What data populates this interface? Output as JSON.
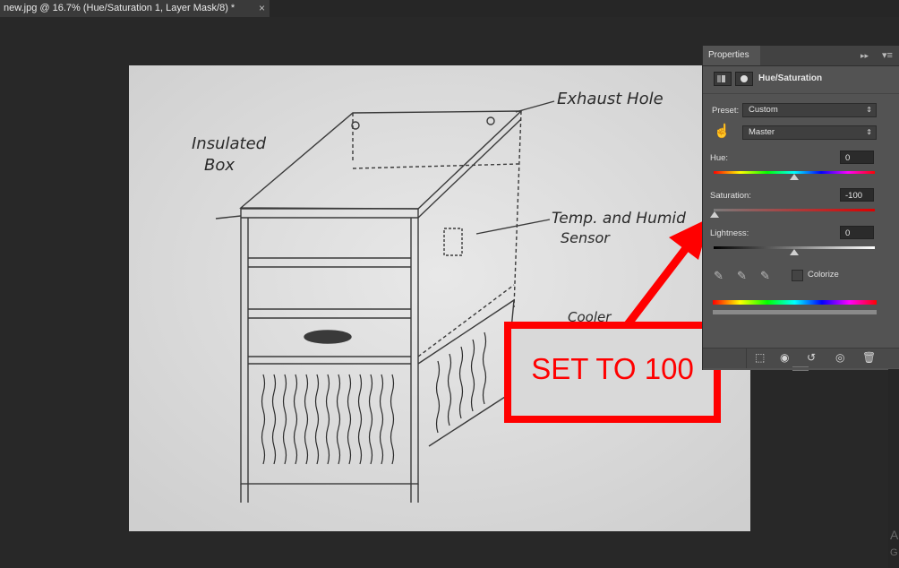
{
  "document": {
    "tab_title": "new.jpg @ 16.7% (Hue/Saturation 1, Layer Mask/8) *",
    "close_glyph": "×"
  },
  "sketch": {
    "labels": {
      "insulated_line1": "Insulated",
      "insulated_line2": "Box",
      "exhaust": "Exhaust Hole",
      "temp_line1": "Temp. and Humid",
      "temp_line2": "Sensor",
      "cooler": "Cooler"
    }
  },
  "annotation": {
    "text": "SET TO 100",
    "color": "#ff0000"
  },
  "properties": {
    "tab_label": "Properties",
    "collapse_glyph": "▸▸",
    "menu_glyph": "▾≡",
    "adjustment_title": "Hue/Saturation",
    "preset_label": "Preset:",
    "preset_value": "Custom",
    "channel_value": "Master",
    "hue_label": "Hue:",
    "hue_value": "0",
    "saturation_label": "Saturation:",
    "saturation_value": "-100",
    "lightness_label": "Lightness:",
    "lightness_value": "0",
    "colorize_label": "Colorize",
    "sliders": {
      "hue_range": [
        -180,
        180
      ],
      "saturation_range": [
        -100,
        100
      ],
      "lightness_range": [
        -100,
        100
      ]
    }
  },
  "footer_icons": [
    "clip-to-layer-icon",
    "view-previous-icon",
    "reset-icon",
    "visibility-eye-icon",
    "trash-icon"
  ],
  "corner": {
    "a": "A",
    "g": "G"
  }
}
